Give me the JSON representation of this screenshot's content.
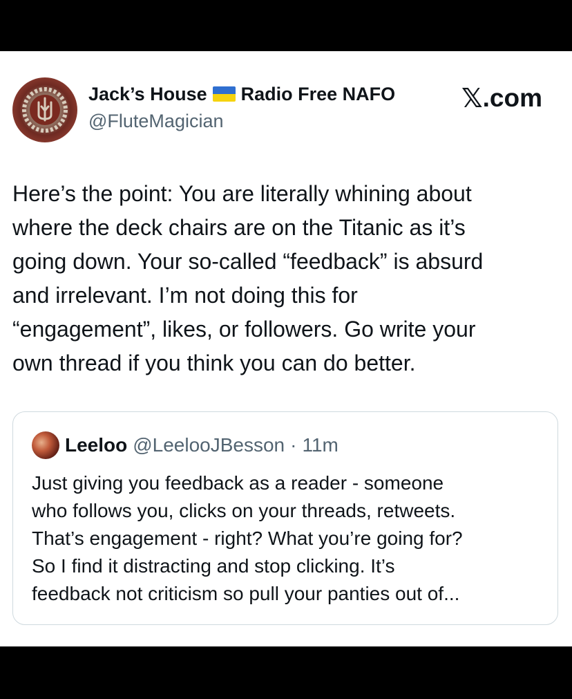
{
  "author": {
    "display_name": "Jack’s House",
    "flag_emoji": "ukraine-flag",
    "display_name_suffix": "Radio Free NAFO",
    "handle": "@FluteMagician",
    "avatar": "trident-emblem-avatar"
  },
  "watermark": {
    "x_glyph": "𝕏",
    "suffix": ".com"
  },
  "tweet": {
    "text": "Here’s the point: You are literally whining about\nwhere the deck chairs are on the Titanic as it’s\ngoing down. Your so-called “feedback” is absurd\nand irrelevant. I’m not doing this for\n“engagement”, likes, or followers. Go write your\nown thread if you think you can do better."
  },
  "quoted_tweet": {
    "display_name": "Leeloo",
    "handle": "@LeelooJBesson",
    "separator": "·",
    "time": "11m",
    "text": "Just giving you feedback as a reader - someone\nwho follows you, clicks on your threads, retweets.\nThat’s engagement - right? What you’re going for?\nSo I find it distracting and stop clicking. It’s\nfeedback not criticism so pull your panties out of..."
  },
  "colors": {
    "text_primary": "#0f1419",
    "text_secondary": "#536471",
    "border": "#cfd9de",
    "flag_blue": "#2f6fd0",
    "flag_yellow": "#f5d30f"
  }
}
